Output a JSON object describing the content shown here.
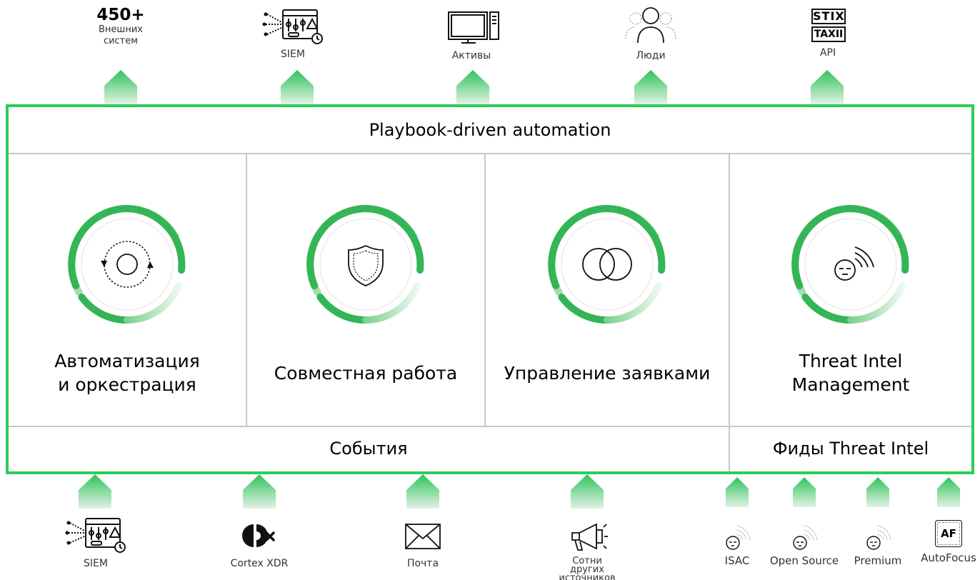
{
  "top": {
    "external": {
      "count": "450+",
      "line1": "Внешних",
      "line2": "систем"
    },
    "siem": {
      "label": "SIEM"
    },
    "assets": {
      "label": "Активы"
    },
    "people": {
      "label": "Люди"
    },
    "api": {
      "label": "API",
      "logo_top": "STIX",
      "logo_bottom": "TAXII"
    }
  },
  "diagram": {
    "header": "Playbook-driven automation",
    "panels": [
      {
        "label": "Автоматизация и оркестрация",
        "icon": "orchestration-icon"
      },
      {
        "label": "Совместная работа",
        "icon": "shield-icon"
      },
      {
        "label": "Управление заявками",
        "icon": "overlapping-circles-icon"
      },
      {
        "label": "Threat Intel Management",
        "icon": "threat-intel-icon"
      }
    ],
    "footer_events": "События",
    "footer_feeds": "Фиды Threat Intel"
  },
  "bottom": {
    "siem": "SIEM",
    "cortex": "Cortex XDR",
    "mail": "Почта",
    "other": "Сотни других источников",
    "isac": "ISAC",
    "open_source": "Open Source",
    "premium": "Premium",
    "autofocus": "AutoFocus",
    "af_logo": "AF"
  },
  "colors": {
    "accent": "#2ecc5a",
    "ring_dark": "#34b556",
    "ring_light": "#a6dcae"
  }
}
